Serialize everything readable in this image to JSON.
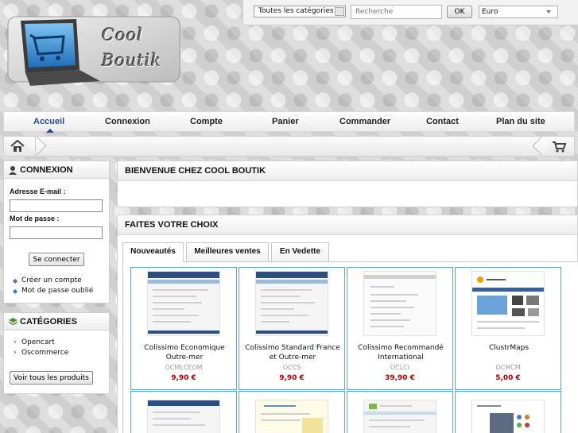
{
  "search": {
    "category_value": "Toutes les catégories",
    "placeholder": "Recherche",
    "ok_label": "OK",
    "currency_value": "Euro"
  },
  "logo": {
    "line1": "Cool",
    "line2": "Boutik"
  },
  "nav": {
    "items": [
      {
        "label": "Accueil",
        "active": true
      },
      {
        "label": "Connexion"
      },
      {
        "label": "Compte"
      },
      {
        "label": "Panier"
      },
      {
        "label": "Commander"
      },
      {
        "label": "Contact"
      },
      {
        "label": "Plan du site"
      }
    ]
  },
  "breadcrumb": {
    "home_icon": "home-icon",
    "cart_icon": "cart-icon"
  },
  "login": {
    "title": "CONNEXION",
    "email_label": "Adresse E-mail :",
    "password_label": "Mot de passe :",
    "submit_label": "Se connecter",
    "links": [
      "Créer un compte",
      "Mot de passe oublié"
    ]
  },
  "categories": {
    "title": "CATÉGORIES",
    "items": [
      "Opencart",
      "Oscommerce"
    ],
    "all_button": "Voir tous les produits"
  },
  "welcome": {
    "title": "BIENVENUE CHEZ COOL BOUTIK"
  },
  "choice": {
    "title": "FAITES VOTRE CHOIX",
    "tabs": [
      "Nouveautés",
      "Meilleures ventes",
      "En Vedette"
    ],
    "products": [
      {
        "name": "Colissimo Economique Outre-mer",
        "code": "OCMLCEOM",
        "price": "9,90 €"
      },
      {
        "name": "Colissimo Standard France et Outre-mer",
        "code": "OCCS",
        "price": "9,90 €"
      },
      {
        "name": "Colissimo Recommandé International",
        "code": "OCLCI",
        "price": "39,90 €"
      },
      {
        "name": "ClustrMaps",
        "code": "OCMCM",
        "price": "5,00 €"
      }
    ]
  },
  "colors": {
    "accent": "#1f4d89",
    "price": "#b00000",
    "card_border": "#5fa0d6"
  }
}
